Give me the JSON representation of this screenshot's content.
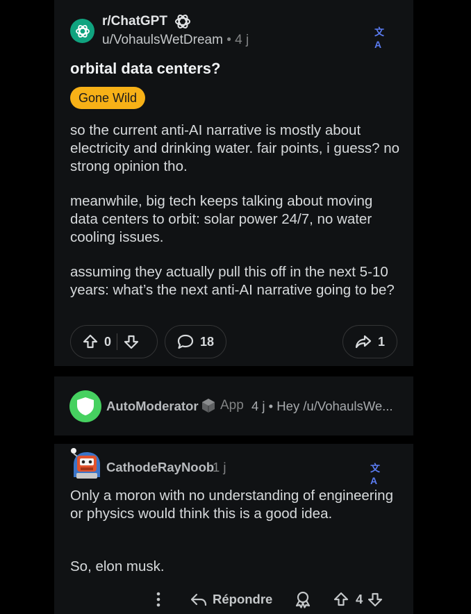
{
  "post": {
    "subreddit": "r/ChatGPT",
    "author": "u/VohaulsWetDream",
    "separator": "•",
    "time": "4 j",
    "translate_icon": "文A",
    "title": "orbital data centers?",
    "flair": "Gone Wild",
    "paragraphs": [
      "so the current anti-AI narrative is mostly about electricity and drinking water. fair points, i guess? no strong opinion tho.",
      "meanwhile, big tech keeps talking about moving data centers to orbit: solar power 24/7, no water cooling issues.",
      "assuming they actually pull this off in the next 5-10 years: what’s the next anti-AI narrative going to be?"
    ],
    "votes": "0",
    "comments": "18",
    "shares": "1",
    "colors": {
      "flair_bg": "#f7b117",
      "subreddit_icon_bg": "#10a37f"
    }
  },
  "automod": {
    "name": "AutoModerator",
    "app_label": "App",
    "meta": "4 j • Hey /u/VohaulsWe...",
    "avatar_color": "#46d160"
  },
  "comment": {
    "author": "CathodeRayNoob",
    "time": "1 j",
    "translate_icon": "文A",
    "paragraphs": [
      "Only a moron with no understanding of engineering or physics would think this is a good idea.",
      "So, elon musk."
    ],
    "reply_label": "Répondre",
    "votes": "4"
  }
}
